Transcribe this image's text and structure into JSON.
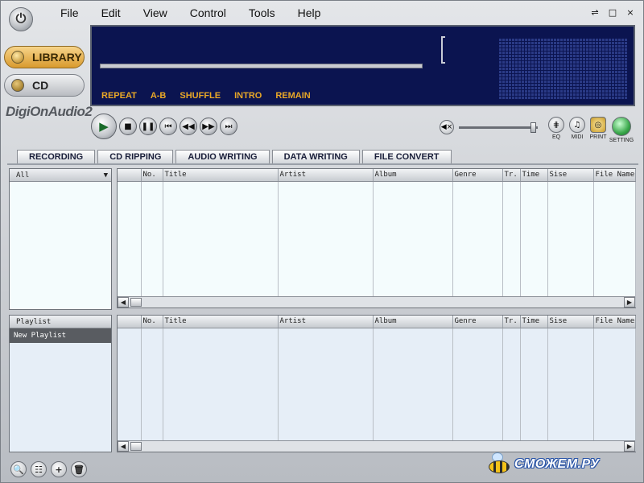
{
  "app": {
    "brand": "DigiOnAudio2"
  },
  "menu": [
    "File",
    "Edit",
    "View",
    "Control",
    "Tools",
    "Help"
  ],
  "window_controls": {
    "minimize": "⇌",
    "restore": "□",
    "close": "×"
  },
  "sidebar": {
    "library_label": "LIBRARY",
    "cd_label": "CD"
  },
  "display": {
    "options": [
      "REPEAT",
      "A-B",
      "SHUFFLE",
      "INTRO",
      "REMAIN"
    ],
    "progress": 0
  },
  "transport": {
    "play": "▶",
    "stop": "■",
    "pause": "❚❚",
    "prev": "⏮",
    "rewind": "◀◀",
    "forward": "▶▶",
    "next": "⏭"
  },
  "volume": {
    "mute_glyph": "◀×",
    "level": 0.98
  },
  "right_tools": {
    "eq": "EQ",
    "midi": "MIDI",
    "print": "PRINT",
    "setting": "SETTING"
  },
  "tabs": [
    "RECORDING",
    "CD RIPPING",
    "AUDIO WRITING",
    "DATA WRITING",
    "FILE CONVERT"
  ],
  "library_panel": {
    "filter_value": "All",
    "dropdown_arrow": "▼"
  },
  "playlist_panel": {
    "header": "Playlist",
    "items": [
      "New Playlist"
    ]
  },
  "track_columns": [
    "No.",
    "Title",
    "Artist",
    "Album",
    "Genre",
    "Tr.",
    "Time",
    "Sise",
    "File Name"
  ],
  "scroll": {
    "left": "◀",
    "right": "▶"
  },
  "bottom_tools": {
    "search": "🔍",
    "list": "☷",
    "add": "+",
    "delete": "🗑"
  },
  "watermark": {
    "text": "СМОЖЕМ.РУ"
  },
  "colors": {
    "display_bg": "#0b1450",
    "display_text": "#e9a827",
    "library_accent": "#d99a2e",
    "setting_green": "#3aa84b"
  }
}
